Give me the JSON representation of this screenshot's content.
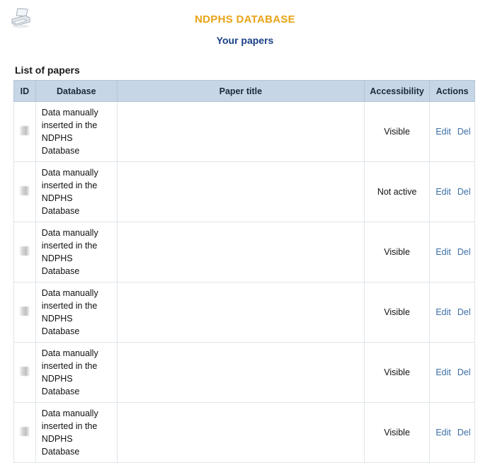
{
  "header": {
    "printer_icon": "printer-icon",
    "app_title": "NDPHS DATABASE",
    "page_subtitle": "Your papers"
  },
  "section": {
    "title": "List of papers"
  },
  "table": {
    "columns": [
      {
        "key": "id",
        "label": "ID"
      },
      {
        "key": "database",
        "label": "Database"
      },
      {
        "key": "paper_title",
        "label": "Paper title"
      },
      {
        "key": "accessibility",
        "label": "Accessibility"
      },
      {
        "key": "actions",
        "label": "Actions"
      }
    ],
    "actions": {
      "edit_label": "Edit",
      "del_label": "Del"
    },
    "rows": [
      {
        "id": "[redacted]",
        "database": "Data manually inserted in the NDPHS Database",
        "paper_title": "[redacted]",
        "title_redaction_lines": 4,
        "accessibility": "Visible"
      },
      {
        "id": "[redacted]",
        "database": "Data manually inserted in the NDPHS Database",
        "paper_title": "[redacted]",
        "title_redaction_lines": 2,
        "accessibility": "Not active"
      },
      {
        "id": "[redacted]",
        "database": "Data manually inserted in the NDPHS Database",
        "paper_title": "[redacted]",
        "title_redaction_lines": 1,
        "accessibility": "Visible"
      },
      {
        "id": "[redacted]",
        "database": "Data manually inserted in the NDPHS Database",
        "paper_title": "[redacted]",
        "title_redaction_lines": 1,
        "accessibility": "Visible"
      },
      {
        "id": "[redacted]",
        "database": "Data manually inserted in the NDPHS Database",
        "paper_title": "[redacted]",
        "title_redaction_lines": 1,
        "accessibility": "Visible"
      },
      {
        "id": "[redacted]",
        "database": "Data manually inserted in the NDPHS Database",
        "paper_title": "[redacted]",
        "title_redaction_lines": 4,
        "accessibility": "Visible"
      }
    ]
  },
  "colors": {
    "app_title": "#e8a317",
    "subtitle": "#1a3f85",
    "table_header_bg": "#c6d6e6",
    "link": "#3a6ea5",
    "page_bg": "#ffffff"
  }
}
